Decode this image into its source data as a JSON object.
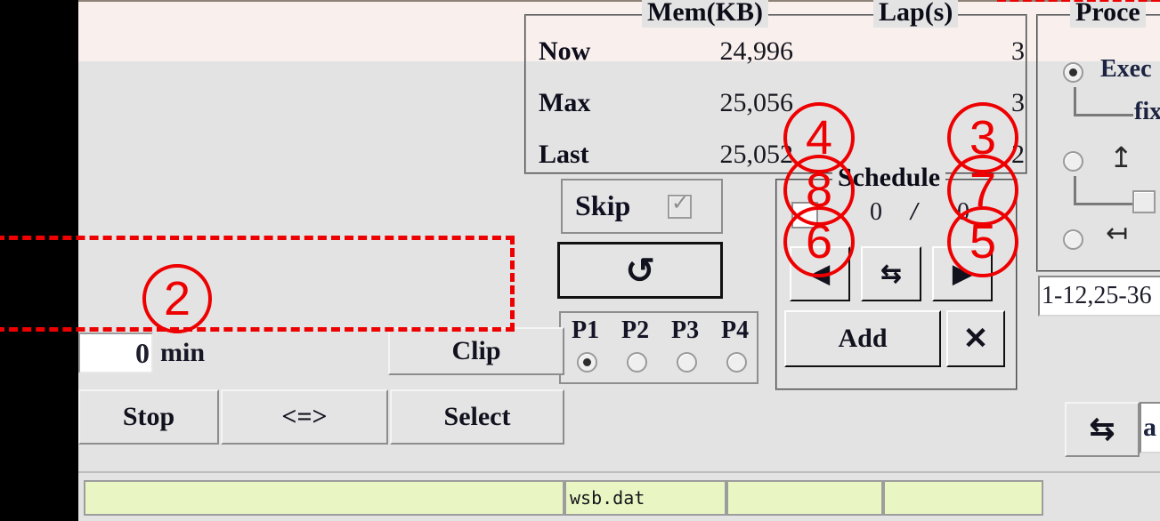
{
  "window": {
    "background_color": "#e3e3e3",
    "top_panel_color": "#f9f0ee"
  },
  "mem_lap_group": {
    "mem_header": "Mem(KB)",
    "lap_header": "Lap(s)",
    "rows": [
      {
        "name": "Now",
        "mem": "24,996",
        "lap": "3"
      },
      {
        "name": "Max",
        "mem": "25,056",
        "lap": "3"
      },
      {
        "name": "Last",
        "mem": "25,052",
        "lap": "2"
      }
    ]
  },
  "process_group": {
    "title": "Proce",
    "option_exec": "Exec",
    "option_fix": "fix",
    "arrow_up_icon": "↑",
    "arrow_left_bar_icon": "⇤",
    "range_value": "1-12,25-36"
  },
  "skip_panel": {
    "label": "Skip",
    "checked": true
  },
  "reload_button": {
    "icon": "↺"
  },
  "p_panel": {
    "options": [
      "P1",
      "P2",
      "P3",
      "P4"
    ],
    "selected_index": 0
  },
  "schedule_group": {
    "title": "Schedule",
    "checked": false,
    "current": "0",
    "separator": "/",
    "total": "0",
    "prev_icon": "◀",
    "swap_icon": "⇆",
    "next_icon": "▶",
    "add_label": "Add",
    "delete_icon": "✕"
  },
  "bottom_controls": {
    "min_value": "0",
    "min_label": "min",
    "clip_label": "Clip",
    "stop_label": "Stop",
    "swap_label": "<=>",
    "select_label": "Select"
  },
  "right_bottom": {
    "io_swap_icon": "⇆",
    "io_text": "a"
  },
  "statusbar": {
    "cells": [
      "",
      "wsb.dat",
      "",
      ""
    ]
  },
  "annotations": {
    "accent_color": "#ee0000",
    "markers": [
      {
        "id": "2",
        "type": "dashed-box"
      },
      {
        "id": "3",
        "type": "circle"
      },
      {
        "id": "4",
        "type": "circle"
      },
      {
        "id": "5",
        "type": "circle"
      },
      {
        "id": "6",
        "type": "circle"
      },
      {
        "id": "7",
        "type": "circle"
      },
      {
        "id": "8",
        "type": "circle"
      }
    ]
  }
}
